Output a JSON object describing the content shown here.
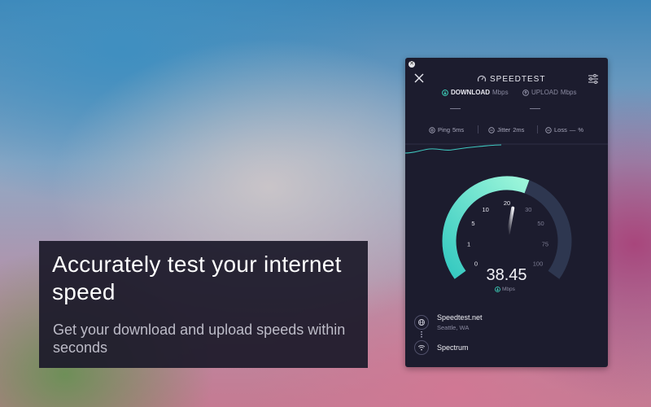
{
  "promo": {
    "headline": "Accurately test your internet speed",
    "subtext": "Get your download and upload speeds within seconds"
  },
  "app": {
    "title": "SPEEDTEST",
    "download": {
      "label": "DOWNLOAD",
      "unit": "Mbps",
      "value": "—"
    },
    "upload": {
      "label": "UPLOAD",
      "unit": "Mbps",
      "value": "—"
    },
    "metrics": {
      "ping": {
        "label": "Ping",
        "value": "5ms"
      },
      "jitter": {
        "label": "Jitter",
        "value": "2ms"
      },
      "loss": {
        "label": "Loss",
        "value": "—",
        "unit": "%"
      }
    },
    "gauge": {
      "ticks": [
        "0",
        "1",
        "5",
        "10",
        "20",
        "30",
        "50",
        "75",
        "100"
      ],
      "current_speed": "38.45",
      "unit": "Mbps",
      "fill_fraction": 0.58
    },
    "server": {
      "name": "Speedtest.net",
      "location": "Seattle, WA"
    },
    "isp": {
      "name": "Spectrum"
    }
  },
  "colors": {
    "accent_start": "#3fe0c5",
    "accent_end": "#7ff0d6",
    "panel": "#1c1c2e",
    "track": "#2e3750"
  },
  "icons": [
    "close-icon",
    "settings-sliders-icon",
    "speedometer-logo-icon",
    "download-arrow-icon",
    "upload-arrow-icon",
    "ping-icon",
    "jitter-icon",
    "loss-icon",
    "globe-icon",
    "wifi-icon"
  ]
}
